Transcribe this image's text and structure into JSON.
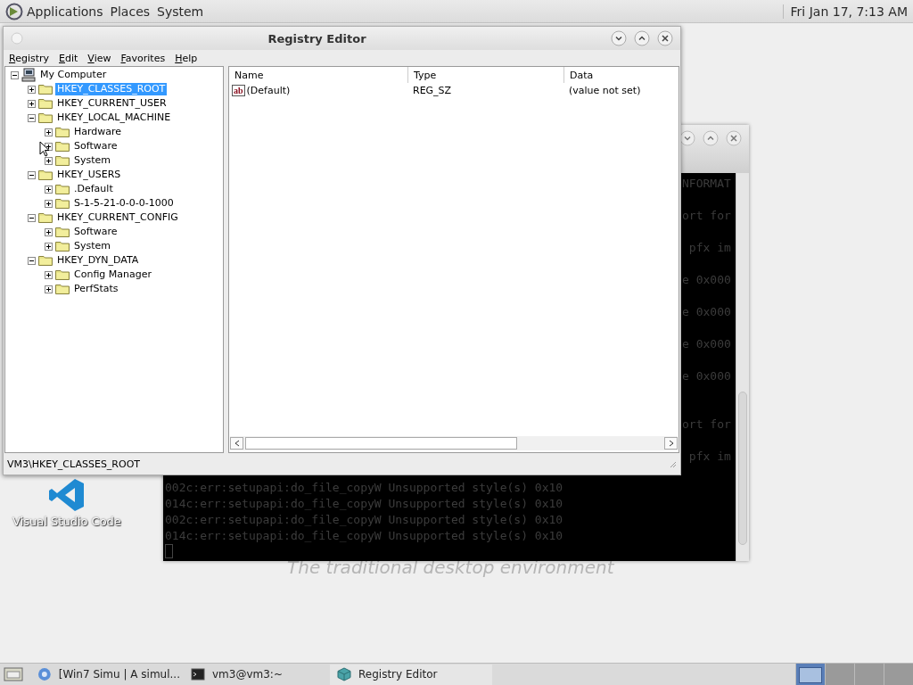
{
  "top_panel": {
    "menus": [
      "Applications",
      "Places",
      "System"
    ],
    "clock": "Fri Jan 17, 7:13 AM"
  },
  "terminal_window": {
    "fragments": [
      "NFORMAT",
      "ort for",
      " pfx im",
      "e 0x000",
      "e 0x000",
      "e 0x000",
      "e 0x000",
      "ort for",
      " pfx im"
    ],
    "lines": [
      "002c:err:setupapi:do_file_copyW Unsupported style(s) 0x10",
      "014c:err:setupapi:do_file_copyW Unsupported style(s) 0x10",
      "002c:err:setupapi:do_file_copyW Unsupported style(s) 0x10",
      "014c:err:setupapi:do_file_copyW Unsupported style(s) 0x10"
    ]
  },
  "registry_editor": {
    "title": "Registry Editor",
    "menu": [
      "Registry",
      "Edit",
      "View",
      "Favorites",
      "Help"
    ],
    "tree": [
      {
        "label": "My Computer",
        "kind": "computer",
        "expanded": true,
        "selected": false,
        "children": [
          {
            "label": "HKEY_CLASSES_ROOT",
            "kind": "folder",
            "expanded": false,
            "selected": true
          },
          {
            "label": "HKEY_CURRENT_USER",
            "kind": "folder",
            "expanded": false,
            "selected": false
          },
          {
            "label": "HKEY_LOCAL_MACHINE",
            "kind": "folder",
            "expanded": true,
            "selected": false,
            "children": [
              {
                "label": "Hardware",
                "kind": "folder",
                "expanded": false,
                "selected": false
              },
              {
                "label": "Software",
                "kind": "folder",
                "expanded": false,
                "selected": false
              },
              {
                "label": "System",
                "kind": "folder",
                "expanded": false,
                "selected": false
              }
            ]
          },
          {
            "label": "HKEY_USERS",
            "kind": "folder",
            "expanded": true,
            "selected": false,
            "children": [
              {
                "label": ".Default",
                "kind": "folder",
                "expanded": false,
                "selected": false
              },
              {
                "label": "S-1-5-21-0-0-0-1000",
                "kind": "folder",
                "expanded": false,
                "selected": false
              }
            ]
          },
          {
            "label": "HKEY_CURRENT_CONFIG",
            "kind": "folder",
            "expanded": true,
            "selected": false,
            "children": [
              {
                "label": "Software",
                "kind": "folder",
                "expanded": false,
                "selected": false
              },
              {
                "label": "System",
                "kind": "folder",
                "expanded": false,
                "selected": false
              }
            ]
          },
          {
            "label": "HKEY_DYN_DATA",
            "kind": "folder",
            "expanded": true,
            "selected": false,
            "children": [
              {
                "label": "Config Manager",
                "kind": "folder",
                "expanded": false,
                "selected": false
              },
              {
                "label": "PerfStats",
                "kind": "folder",
                "expanded": false,
                "selected": false
              }
            ]
          }
        ]
      }
    ],
    "list": {
      "columns": [
        "Name",
        "Type",
        "Data"
      ],
      "rows": [
        {
          "icon_text": "ab",
          "name": "(Default)",
          "type": "REG_SZ",
          "data": "(value not set)"
        }
      ]
    },
    "status": "VM3\\HKEY_CLASSES_ROOT"
  },
  "desktop_icons": [
    {
      "label": "Visual Studio Code"
    }
  ],
  "tagline": "The traditional desktop environment",
  "taskbar": {
    "items": [
      {
        "kind": "browser",
        "label": "[Win7 Simu | A simul...",
        "selected": false
      },
      {
        "kind": "terminal",
        "label": "vm3@vm3:~",
        "selected": false
      },
      {
        "kind": "registry",
        "label": "Registry Editor",
        "selected": true
      }
    ],
    "workspaces": [
      {
        "selected": true
      },
      {
        "selected": false
      },
      {
        "selected": false
      },
      {
        "selected": false
      }
    ]
  }
}
